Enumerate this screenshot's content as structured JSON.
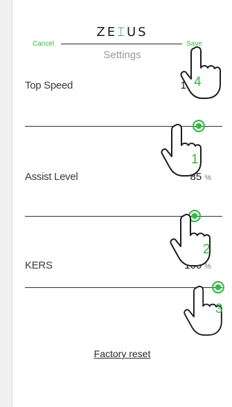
{
  "header": {
    "logo": "ZE⌶US",
    "logo_left": "ZE",
    "logo_mid": "⌶",
    "logo_right": "US",
    "cancel_label": "Cancel",
    "save_label": "Save",
    "title": "Settings"
  },
  "settings": [
    {
      "label": "Top Speed",
      "value": "18",
      "unit": "km/h",
      "slider_fraction": 0.88
    },
    {
      "label": "Assist Level",
      "value": "85",
      "unit": "%",
      "slider_fraction": 0.86
    },
    {
      "label": "KERS",
      "value": "100",
      "unit": "%",
      "slider_fraction": 0.98
    }
  ],
  "footer": {
    "factory_reset_label": "Factory reset"
  },
  "hints": [
    {
      "step": "1"
    },
    {
      "step": "2"
    },
    {
      "step": "3"
    },
    {
      "step": "4"
    }
  ],
  "colors": {
    "accent": "#39b54a",
    "text": "#1b1b1b",
    "muted": "#9a9a9a",
    "background": "#ffffff"
  },
  "icons": {
    "hand": "pointing-hand-icon"
  }
}
